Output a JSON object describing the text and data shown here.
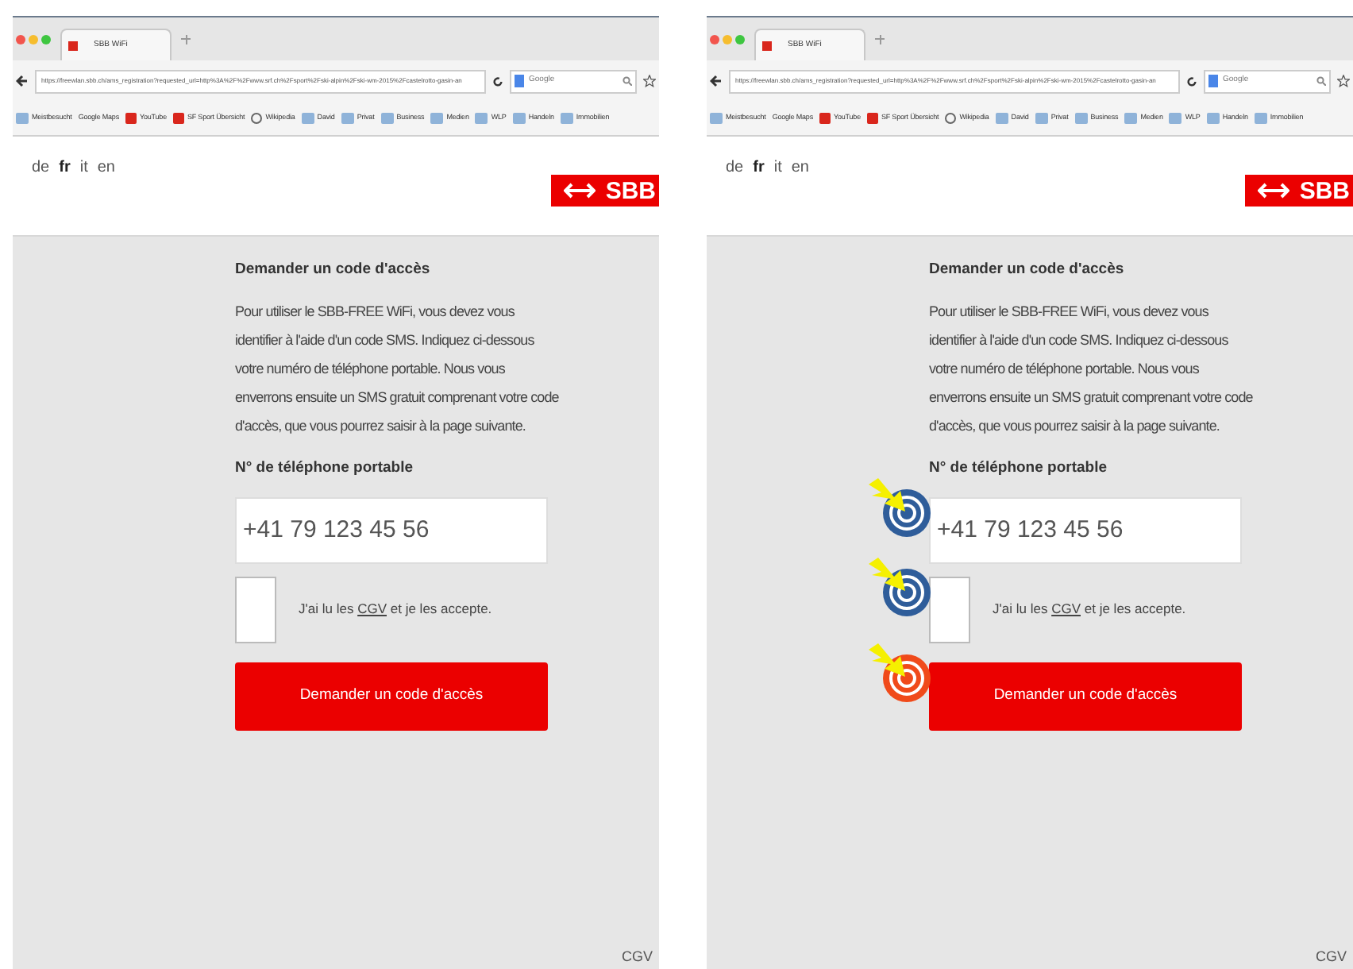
{
  "panels": [
    {
      "browser": {
        "tab_title": "SBB WiFi",
        "url": "https://freewlan.sbb.ch/ams_registration?requested_url=http%3A%2F%2Fwww.srf.ch%2Fsport%2Fski-alpin%2Fski-wm-2015%2Fcastelrotto-gasin-an",
        "search_placeholder": "Google",
        "bookmarks": [
          {
            "label": "Meistbesucht",
            "kind": "folder"
          },
          {
            "label": "Google Maps",
            "kind": "plain"
          },
          {
            "label": "YouTube",
            "kind": "red"
          },
          {
            "label": "SF Sport Übersicht",
            "kind": "red"
          },
          {
            "label": "Wikipedia",
            "kind": "wiki"
          },
          {
            "label": "David",
            "kind": "folder"
          },
          {
            "label": "Privat",
            "kind": "folder"
          },
          {
            "label": "Business",
            "kind": "folder"
          },
          {
            "label": "Medien",
            "kind": "folder"
          },
          {
            "label": "WLP",
            "kind": "folder"
          },
          {
            "label": "Handeln",
            "kind": "folder"
          },
          {
            "label": "Immobilien",
            "kind": "folder"
          }
        ]
      },
      "languages": [
        {
          "label": "de",
          "selected": false
        },
        {
          "label": "fr",
          "selected": true
        },
        {
          "label": "it",
          "selected": false
        },
        {
          "label": "en",
          "selected": false
        }
      ],
      "logo_text": "SBB",
      "heading": "Demander un code d'accès",
      "intro": "Pour utiliser le SBB-FREE WiFi, vous devez vous identifier à l'aide d'un code SMS. Indiquez ci-dessous votre numéro de téléphone portable. Nous vous enverrons ensuite un SMS gratuit comprenant votre code d'accès, que vous pourrez saisir à la page suivante.",
      "phone_label": "N° de téléphone portable",
      "phone": {
        "placeholder": "+41 79 123 45 56"
      },
      "terms": {
        "checked": false,
        "before": "J'ai lu les",
        "link": "CGV",
        "after": "et je les accepte."
      },
      "submit": {
        "label": "Demander un code d'accès"
      },
      "footer_link": "CGV"
    },
    {
      "browser": {
        "tab_title": "SBB WiFi",
        "url": "https://freewlan.sbb.ch/ams_registration?requested_url=http%3A%2F%2Fwww.srf.ch%2Fsport%2Fski-alpin%2Fski-wm-2015%2Fcastelrotto-gasin-an",
        "search_placeholder": "Google",
        "bookmarks": [
          {
            "label": "Meistbesucht",
            "kind": "folder"
          },
          {
            "label": "Google Maps",
            "kind": "plain"
          },
          {
            "label": "YouTube",
            "kind": "red"
          },
          {
            "label": "SF Sport Übersicht",
            "kind": "red"
          },
          {
            "label": "Wikipedia",
            "kind": "wiki"
          },
          {
            "label": "David",
            "kind": "folder"
          },
          {
            "label": "Privat",
            "kind": "folder"
          },
          {
            "label": "Business",
            "kind": "folder"
          },
          {
            "label": "Medien",
            "kind": "folder"
          },
          {
            "label": "WLP",
            "kind": "folder"
          },
          {
            "label": "Handeln",
            "kind": "folder"
          },
          {
            "label": "Immobilien",
            "kind": "folder"
          }
        ]
      },
      "languages": [
        {
          "label": "de",
          "selected": false
        },
        {
          "label": "fr",
          "selected": true
        },
        {
          "label": "it",
          "selected": false
        },
        {
          "label": "en",
          "selected": false
        }
      ],
      "logo_text": "SBB",
      "heading": "Demander un code d'accès",
      "intro": "Pour utiliser le SBB-FREE WiFi, vous devez vous identifier à l'aide d'un code SMS. Indiquez ci-dessous votre numéro de téléphone portable. Nous vous enverrons ensuite un SMS gratuit comprenant votre code d'accès, que vous pourrez saisir à la page suivante.",
      "phone_label": "N° de téléphone portable",
      "phone": {
        "placeholder": "+41 79 123 45 56",
        "marker": {
          "color": "#2f5d9a"
        }
      },
      "terms": {
        "checked": false,
        "before": "J'ai lu les",
        "link": "CGV",
        "after": "et je les accepte.",
        "marker": {
          "color": "#2f5d9a"
        }
      },
      "submit": {
        "label": "Demander un code d'accès",
        "marker": {
          "color": "#f04a1a"
        }
      },
      "footer_link": "CGV"
    }
  ]
}
